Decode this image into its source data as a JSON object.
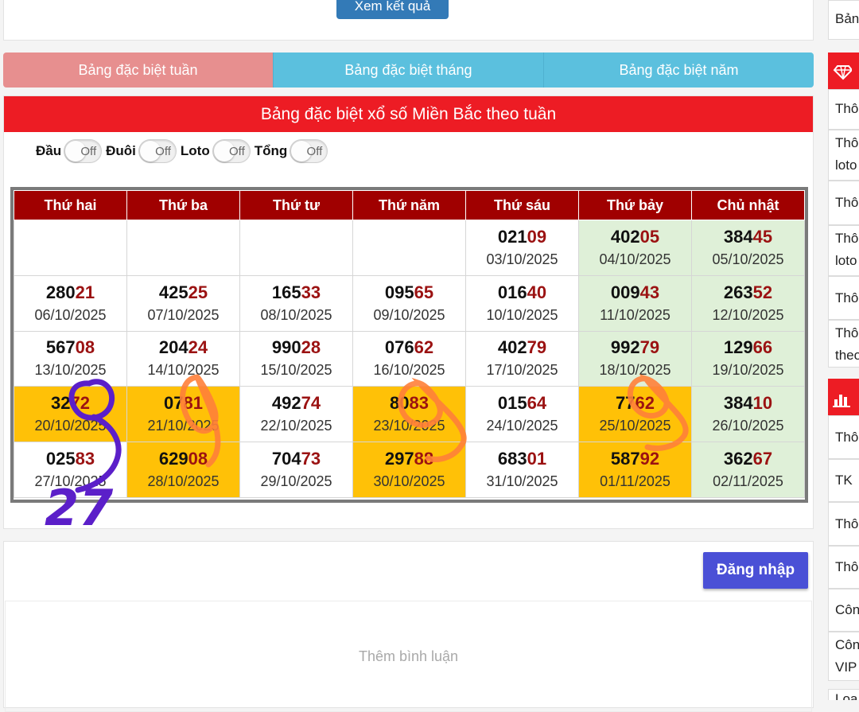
{
  "top": {
    "view_button": "Xem kết quả"
  },
  "tabs": [
    {
      "label": "Bảng đặc biệt tuần",
      "active": true
    },
    {
      "label": "Bảng đặc biệt tháng",
      "active": false
    },
    {
      "label": "Bảng đặc biệt năm",
      "active": false
    }
  ],
  "panel_title": "Bảng đặc biệt xổ số Miền Bắc theo tuần",
  "toggles": [
    {
      "label": "Đầu",
      "state": "Off"
    },
    {
      "label": "Đuôi",
      "state": "Off"
    },
    {
      "label": "Loto",
      "state": "Off"
    },
    {
      "label": "Tổng",
      "state": "Off"
    }
  ],
  "table": {
    "headers": [
      "Thứ hai",
      "Thứ ba",
      "Thứ tư",
      "Thứ năm",
      "Thứ sáu",
      "Thứ bảy",
      "Chủ nhật"
    ],
    "rows": [
      [
        {
          "head": "",
          "tail": "",
          "date": "",
          "bg": "none"
        },
        {
          "head": "",
          "tail": "",
          "date": "",
          "bg": "none"
        },
        {
          "head": "",
          "tail": "",
          "date": "",
          "bg": "none"
        },
        {
          "head": "",
          "tail": "",
          "date": "",
          "bg": "none"
        },
        {
          "head": "021",
          "tail": "09",
          "date": "03/10/2025",
          "bg": "none"
        },
        {
          "head": "402",
          "tail": "05",
          "date": "04/10/2025",
          "bg": "green"
        },
        {
          "head": "384",
          "tail": "45",
          "date": "05/10/2025",
          "bg": "green"
        }
      ],
      [
        {
          "head": "280",
          "tail": "21",
          "date": "06/10/2025",
          "bg": "none"
        },
        {
          "head": "425",
          "tail": "25",
          "date": "07/10/2025",
          "bg": "none"
        },
        {
          "head": "165",
          "tail": "33",
          "date": "08/10/2025",
          "bg": "none"
        },
        {
          "head": "095",
          "tail": "65",
          "date": "09/10/2025",
          "bg": "none"
        },
        {
          "head": "016",
          "tail": "40",
          "date": "10/10/2025",
          "bg": "none"
        },
        {
          "head": "009",
          "tail": "43",
          "date": "11/10/2025",
          "bg": "green"
        },
        {
          "head": "263",
          "tail": "52",
          "date": "12/10/2025",
          "bg": "green"
        }
      ],
      [
        {
          "head": "567",
          "tail": "08",
          "date": "13/10/2025",
          "bg": "none"
        },
        {
          "head": "204",
          "tail": "24",
          "date": "14/10/2025",
          "bg": "none"
        },
        {
          "head": "990",
          "tail": "28",
          "date": "15/10/2025",
          "bg": "none"
        },
        {
          "head": "076",
          "tail": "62",
          "date": "16/10/2025",
          "bg": "none"
        },
        {
          "head": "402",
          "tail": "79",
          "date": "17/10/2025",
          "bg": "none"
        },
        {
          "head": "992",
          "tail": "79",
          "date": "18/10/2025",
          "bg": "green"
        },
        {
          "head": "129",
          "tail": "66",
          "date": "19/10/2025",
          "bg": "green"
        }
      ],
      [
        {
          "head": "32",
          "tail": "72",
          "date": "20/10/2025",
          "bg": "yellow"
        },
        {
          "head": "07",
          "tail": "81",
          "date": "21/10/2025",
          "bg": "yellow"
        },
        {
          "head": "492",
          "tail": "74",
          "date": "22/10/2025",
          "bg": "none"
        },
        {
          "head": "80",
          "tail": "83",
          "date": "23/10/2025",
          "bg": "yellow"
        },
        {
          "head": "015",
          "tail": "64",
          "date": "24/10/2025",
          "bg": "none"
        },
        {
          "head": "77",
          "tail": "62",
          "date": "25/10/2025",
          "bg": "yellow"
        },
        {
          "head": "384",
          "tail": "10",
          "date": "26/10/2025",
          "bg": "green"
        }
      ],
      [
        {
          "head": "025",
          "tail": "83",
          "date": "27/10/2025",
          "bg": "none"
        },
        {
          "head": "629",
          "tail": "08",
          "date": "28/10/2025",
          "bg": "yellow"
        },
        {
          "head": "704",
          "tail": "73",
          "date": "29/10/2025",
          "bg": "none"
        },
        {
          "head": "297",
          "tail": "88",
          "date": "30/10/2025",
          "bg": "yellow"
        },
        {
          "head": "683",
          "tail": "01",
          "date": "31/10/2025",
          "bg": "none"
        },
        {
          "head": "587",
          "tail": "92",
          "date": "01/11/2025",
          "bg": "yellow"
        },
        {
          "head": "362",
          "tail": "67",
          "date": "02/11/2025",
          "bg": "green"
        }
      ]
    ]
  },
  "comments": {
    "login_button": "Đăng nhập",
    "placeholder": "Thêm bình luận"
  },
  "sidebar": {
    "items": [
      "Bản",
      "Thô",
      "Thô",
      "loto",
      "Thô",
      "Thô",
      "loto",
      "Thô",
      "Thô",
      "theo",
      "Thô",
      "TK",
      "Thô",
      "Thô",
      "Côn",
      "Côn",
      "VIP",
      "Loa"
    ]
  },
  "handwriting": {
    "annotation": "27"
  },
  "colors": {
    "tab_active": "#e78f8f",
    "tab": "#5bc0de",
    "title_bar": "#ed1c24",
    "header": "#a00000",
    "highlight_green": "#dff0d8",
    "highlight_yellow": "#ffc107",
    "tail_digits": "#9b1212",
    "login": "#4a50d6",
    "ink_purple": "#5b1fc9",
    "ink_orange": "#ff7f3a"
  }
}
